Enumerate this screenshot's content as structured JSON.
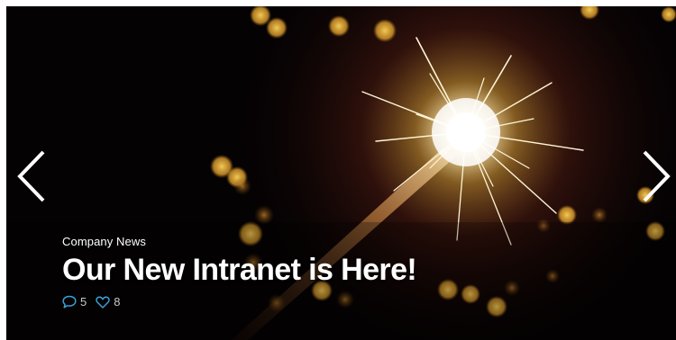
{
  "slide": {
    "category": "Company News",
    "title": "Our New Intranet is Here!",
    "comments_count": "5",
    "likes_count": "8"
  },
  "icons": {
    "prev": "chevron-left-icon",
    "next": "chevron-right-icon",
    "comments": "speech-bubble-icon",
    "likes": "heart-icon"
  },
  "colors": {
    "icon_accent": "#3aa0d8",
    "text": "#ffffff",
    "meta_text": "#c9c9c9"
  }
}
